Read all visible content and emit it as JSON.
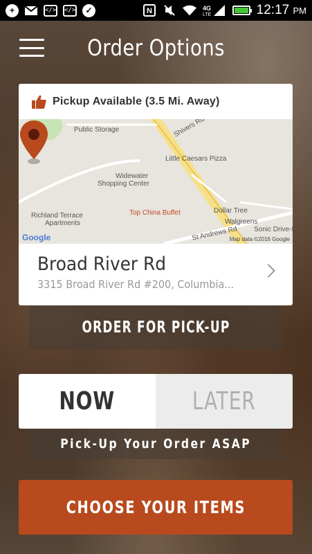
{
  "status_bar": {
    "left_icons": [
      "add-icon",
      "mail-icon",
      "code-icon",
      "code-icon",
      "check-icon"
    ],
    "right_icons": [
      "nfc-icon",
      "mute-icon",
      "wifi-icon",
      "lte-signal-icon",
      "battery-icon"
    ],
    "network": "4G LTE",
    "battery_level": 1.0,
    "time": "12:17",
    "ampm": "PM"
  },
  "header": {
    "title": "Order Options"
  },
  "location_card": {
    "pickup_text": "Pickup Available (3.5 Mi. Away)",
    "map": {
      "labels": {
        "public_storage": "Public Storage",
        "shivers_rd": "Shivers Rd",
        "little_caesars": "Little Caesars Pizza",
        "widewater": "Widewater",
        "shopping_center": "Shopping Center",
        "richland_1": "Richland Terrace",
        "richland_2": "Apartments",
        "top_china": "Top China Buffet",
        "dollar_tree": "Dollar Tree",
        "walgreens": "Walgreens",
        "st_andrews": "St Andrews Rd",
        "sonic": "Sonic Drive-In",
        "google": "Google",
        "credit": "Map data ©2016 Google"
      }
    },
    "store_name": "Broad River Rd",
    "store_address": "3315 Broad River Rd #200, Columbia..."
  },
  "order_button": "ORDER FOR PICK-UP",
  "timing": {
    "now_label": "NOW",
    "later_label": "LATER",
    "selected": "NOW",
    "message": "Pick-Up Your Order ASAP"
  },
  "choose_button": "CHOOSE YOUR ITEMS",
  "colors": {
    "accent": "#b84a1e",
    "battery": "#44c63a"
  }
}
